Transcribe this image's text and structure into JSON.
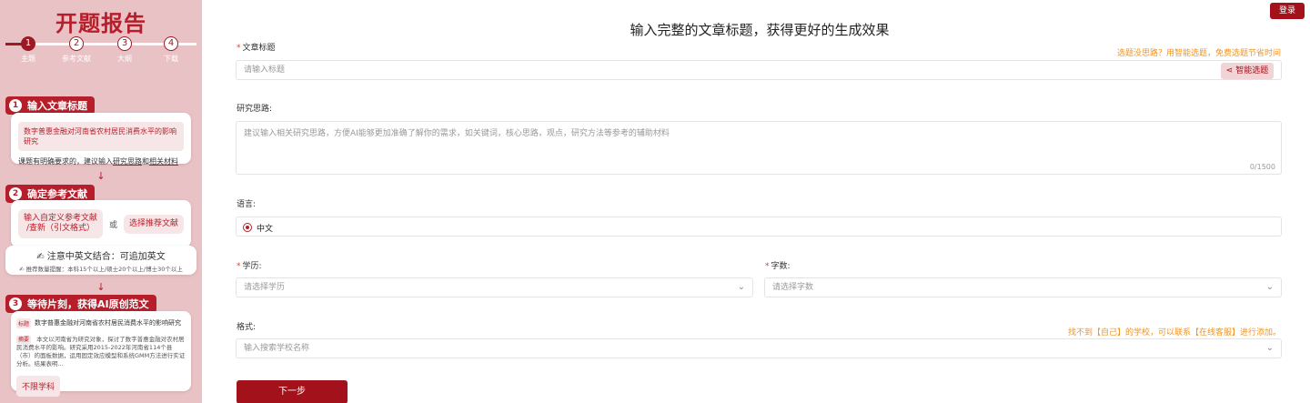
{
  "sidebar": {
    "title": "开题报告",
    "steps": [
      {
        "num": "1",
        "label": "主题"
      },
      {
        "num": "2",
        "label": "参考文献"
      },
      {
        "num": "3",
        "label": "大纲"
      },
      {
        "num": "4",
        "label": "下载"
      }
    ],
    "section1": {
      "num": "1",
      "title": "输入文章标题",
      "example_chip": "数字普惠金融对河南省农村居民消费水平的影响研究",
      "hint_prefix": "课题有明确要求的，建议输入",
      "hint_link1": "研究思路",
      "hint_and": "和",
      "hint_link2": "相关材料"
    },
    "arrow": "↓",
    "section2": {
      "num": "2",
      "title": "确定参考文献",
      "custom_ref": "输入自定义参考文献\n/查新（引文格式）",
      "or": "或",
      "recommend": "选择推荐文献",
      "note_title": "注意中英文结合：可追加英文",
      "note_detail": "推荐数量提醒：本科15个以上/硕士20个以上/博士30个以上"
    },
    "section3": {
      "num": "3",
      "title": "等待片刻，获得AI原创范文",
      "title_tag": "标题",
      "sample_title": "数字普惠金融对河南省农村居民消费水平的影响研究",
      "abstract_tag": "摘要",
      "abstract": "本文以河南省为研究对象，探讨了数字普惠金融对农村居民消费水平的影响。研究采用2015-2022年河南省114个县（市）的面板数据，运用固定效应模型和系统GMM方法进行实证分析。结果表明...",
      "subject": "不限学科"
    }
  },
  "header": {
    "login": "登录",
    "title": "输入完整的文章标题，获得更好的生成效果"
  },
  "form": {
    "title_label": "文章标题",
    "title_hint": "选题没思路？用智能选题，免费选题节省时间",
    "title_placeholder": "请输入标题",
    "smart_btn": "智能选题",
    "idea_label": "研究思路:",
    "idea_placeholder": "建议输入相关研究思路，方便AI能够更加准确了解你的需求，如关键词，核心思路，观点，研究方法等参考的辅助材料",
    "idea_counter": "0/1500",
    "lang_label": "语言:",
    "lang_value": "中文",
    "degree_label": "学历:",
    "degree_placeholder": "请选择学历",
    "words_label": "字数:",
    "words_placeholder": "请选择字数",
    "format_label": "格式:",
    "format_hint": "找不到【自己】的学校，可以联系【在线客服】进行添加。",
    "format_placeholder": "输入搜索学校名称",
    "next": "下一步"
  },
  "colors": {
    "brand": "#a3111b",
    "sidebar_bg": "#e9c2c5",
    "hint_orange": "#f29420"
  }
}
